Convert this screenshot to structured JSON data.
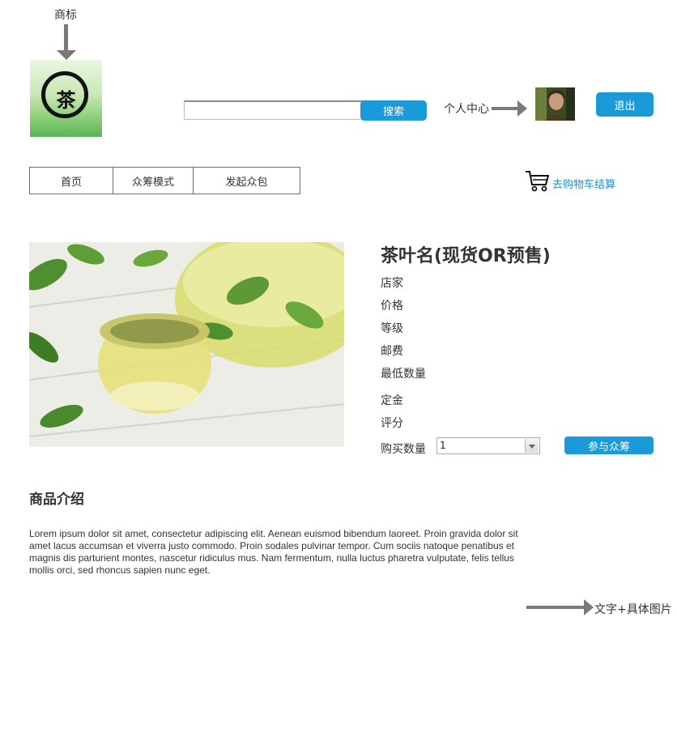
{
  "annotations": {
    "logo_label": "商标",
    "profile_label": "个人中心",
    "detail_label": "文字+具体图片"
  },
  "logo": {
    "char": "茶"
  },
  "search": {
    "value": "",
    "button_label": "搜索"
  },
  "header": {
    "logout_label": "退出"
  },
  "nav": {
    "items": [
      "首页",
      "众筹模式",
      "发起众包"
    ]
  },
  "cart": {
    "label": "去购物车结算",
    "icon": "shopping-cart-icon"
  },
  "product": {
    "image": "green-tea-photo",
    "title": "茶叶名(现货OR预售)",
    "fields": {
      "shop": "店家",
      "price": "价格",
      "grade": "等级",
      "shipping": "邮费",
      "min_qty": "最低数量",
      "deposit": "定金",
      "rating": "评分",
      "buy_qty": "购买数量"
    },
    "quantity_value": "1",
    "join_button": "参与众筹"
  },
  "intro": {
    "title": "商品介绍",
    "text": "Lorem ipsum dolor sit amet, consectetur adipiscing elit. Aenean euismod bibendum laoreet. Proin gravida dolor sit amet lacus accumsan et viverra justo commodo. Proin sodales pulvinar tempor. Cum sociis natoque penatibus et magnis dis parturient montes, nascetur ridiculus mus. Nam fermentum, nulla luctus pharetra vulputate, felis tellus mollis orci, sed rhoncus sapien nunc eget."
  },
  "colors": {
    "accent": "#1a9ad9",
    "link": "#1a8fd0",
    "annotation_arrow": "#7a7a7a"
  }
}
